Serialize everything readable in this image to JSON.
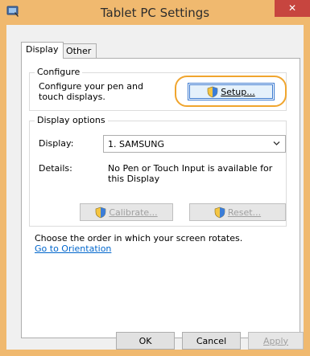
{
  "window": {
    "title": "Tablet PC Settings",
    "close_glyph": "✕"
  },
  "tabs": [
    {
      "label": "Display",
      "selected": true
    },
    {
      "label": "Other",
      "selected": false
    }
  ],
  "configure": {
    "legend": "Configure",
    "description": "Configure your pen and touch displays.",
    "setup_button": "Setup..."
  },
  "display_options": {
    "legend": "Display options",
    "display_label": "Display:",
    "display_value": "1. SAMSUNG",
    "details_label": "Details:",
    "details_value": "No Pen or Touch Input is available for this Display",
    "calibrate_button": "Calibrate...",
    "reset_button": "Reset..."
  },
  "orientation": {
    "description": "Choose the order in which your screen rotates.",
    "link": "Go to Orientation"
  },
  "footer": {
    "ok": "OK",
    "cancel": "Cancel",
    "apply": "Apply"
  },
  "icons": {
    "app": "tablet-pc-icon",
    "shield": "uac-shield-icon",
    "dropdown": "chevron-down-icon"
  },
  "colors": {
    "frame": "#f0b96f",
    "close": "#c7453f",
    "highlight": "#f0a52e",
    "link": "#0066cc"
  }
}
